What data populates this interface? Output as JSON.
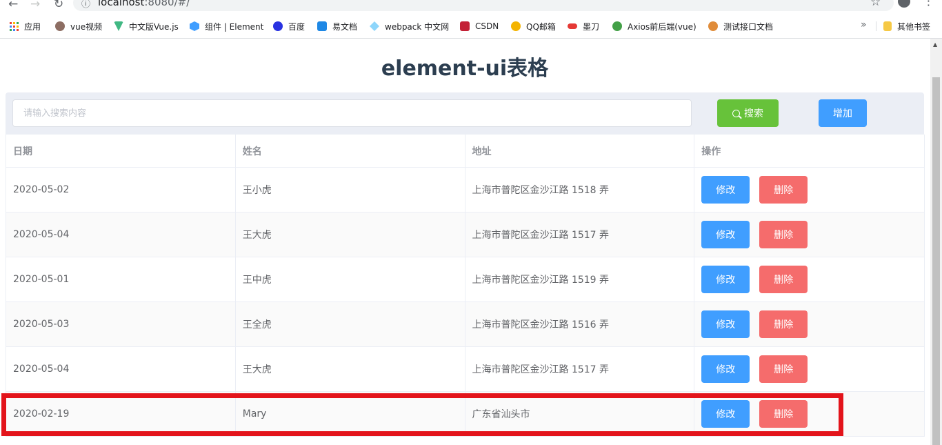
{
  "browser": {
    "url_host": "localhost",
    "url_rest": ":8080/#/",
    "bookmarks": [
      {
        "label": "应用",
        "color": "#4285f4"
      },
      {
        "label": "vue视频",
        "color": "#8d6e63"
      },
      {
        "label": "中文版Vue.js",
        "color": "#41b883"
      },
      {
        "label": "组件 | Element",
        "color": "#409eff"
      },
      {
        "label": "百度",
        "color": "#2932e1"
      },
      {
        "label": "易文档",
        "color": "#1e88e5"
      },
      {
        "label": "webpack 中文网",
        "color": "#8ed6fb"
      },
      {
        "label": "CSDN",
        "color": "#c32136"
      },
      {
        "label": "QQ邮箱",
        "color": "#f4b400"
      },
      {
        "label": "墨刀",
        "color": "#e53935"
      },
      {
        "label": "Axios前后端(vue)",
        "color": "#43a047"
      },
      {
        "label": "测试接口文档",
        "color": "#e08c3a"
      },
      {
        "label": "其他书签",
        "color": "#f6c945"
      }
    ],
    "more_glyph": "»"
  },
  "page": {
    "title": "element-ui表格"
  },
  "toolbar": {
    "search_placeholder": "请输入搜索内容",
    "search_label": "搜索",
    "add_label": "增加"
  },
  "table": {
    "headers": [
      "日期",
      "姓名",
      "地址",
      "操作"
    ],
    "edit_label": "修改",
    "delete_label": "删除",
    "rows": [
      {
        "date": "2020-05-02",
        "name": "王小虎",
        "address": "上海市普陀区金沙江路 1518 弄"
      },
      {
        "date": "2020-05-04",
        "name": "王大虎",
        "address": "上海市普陀区金沙江路 1517 弄"
      },
      {
        "date": "2020-05-01",
        "name": "王中虎",
        "address": "上海市普陀区金沙江路 1519 弄"
      },
      {
        "date": "2020-05-03",
        "name": "王全虎",
        "address": "上海市普陀区金沙江路 1516 弄"
      },
      {
        "date": "2020-05-04",
        "name": "王大虎",
        "address": "上海市普陀区金沙江路 1517 弄"
      },
      {
        "date": "2020-02-19",
        "name": "Mary",
        "address": "广东省汕头市"
      }
    ]
  },
  "colors": {
    "primary": "#409eff",
    "success": "#67c23a",
    "danger": "#f56c6c",
    "highlight": "#e3141b"
  }
}
